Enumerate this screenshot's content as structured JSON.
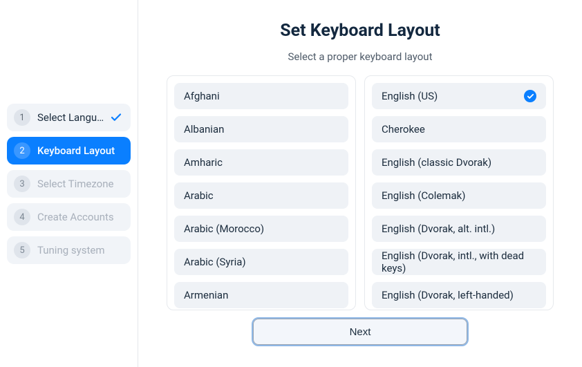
{
  "header": {
    "title": "Set Keyboard Layout",
    "subtitle": "Select a proper keyboard layout"
  },
  "sidebar": {
    "steps": [
      {
        "num": "1",
        "label": "Select Langu…",
        "state": "completed"
      },
      {
        "num": "2",
        "label": "Keyboard Layout",
        "state": "active"
      },
      {
        "num": "3",
        "label": "Select Timezone",
        "state": "pending"
      },
      {
        "num": "4",
        "label": "Create Accounts",
        "state": "pending"
      },
      {
        "num": "5",
        "label": "Tuning system",
        "state": "pending"
      }
    ]
  },
  "left_list": [
    "Afghani",
    "Albanian",
    "Amharic",
    "Arabic",
    "Arabic (Morocco)",
    "Arabic (Syria)",
    "Armenian"
  ],
  "right_list": [
    "English (US)",
    "Cherokee",
    "English (classic Dvorak)",
    "English (Colemak)",
    "English (Dvorak, alt. intl.)",
    "English (Dvorak, intl., with dead keys)",
    "English (Dvorak, left-handed)"
  ],
  "right_selected": "English (US)",
  "buttons": {
    "next": "Next"
  }
}
